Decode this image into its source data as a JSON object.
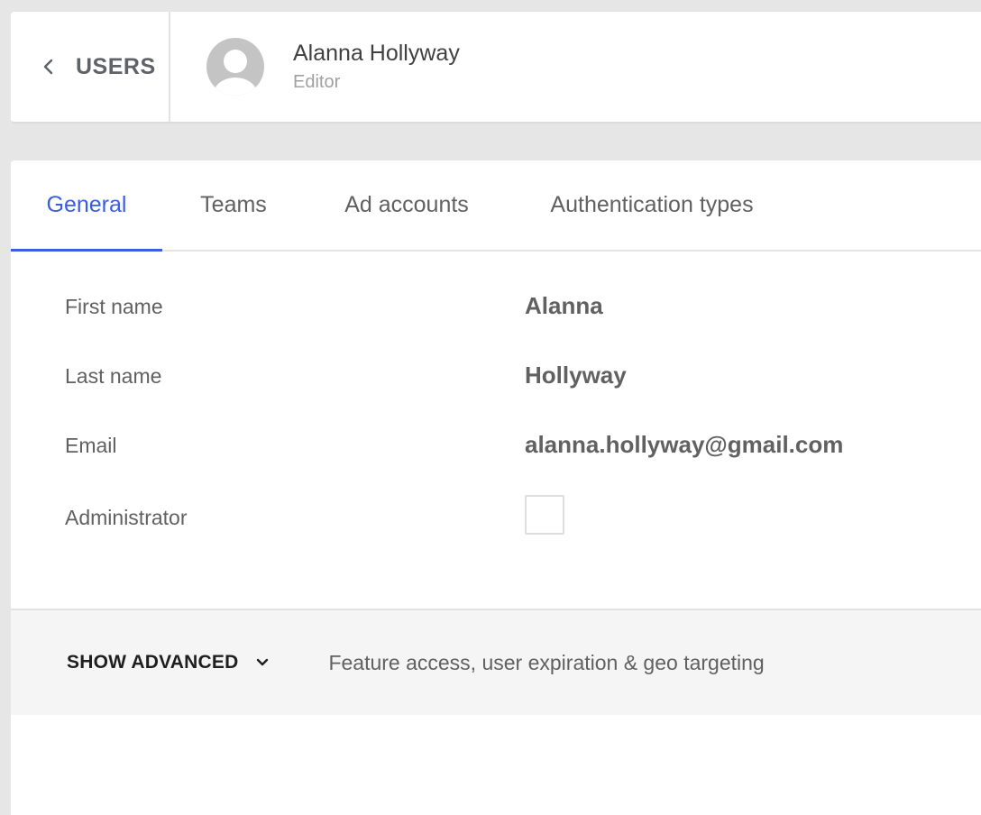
{
  "header": {
    "back_label": "USERS",
    "user_name": "Alanna Hollyway",
    "user_role": "Editor"
  },
  "tabs": [
    {
      "label": "General",
      "active": true
    },
    {
      "label": "Teams",
      "active": false
    },
    {
      "label": "Ad accounts",
      "active": false
    },
    {
      "label": "Authentication types",
      "active": false
    }
  ],
  "fields": {
    "first_name": {
      "label": "First name",
      "value": "Alanna"
    },
    "last_name": {
      "label": "Last name",
      "value": "Hollyway"
    },
    "email": {
      "label": "Email",
      "value": "alanna.hollyway@gmail.com"
    },
    "administrator": {
      "label": "Administrator",
      "checked": false
    }
  },
  "advanced": {
    "toggle_label": "SHOW ADVANCED",
    "description": "Feature access, user expiration & geo targeting"
  },
  "colors": {
    "accent": "#3b5ce4",
    "background": "#e6e6e6",
    "panel": "#ffffff",
    "advanced_bg": "#f5f5f5"
  },
  "icons": {
    "back": "chevron-left-icon",
    "avatar": "user-avatar-icon",
    "expand": "chevron-down-icon"
  }
}
